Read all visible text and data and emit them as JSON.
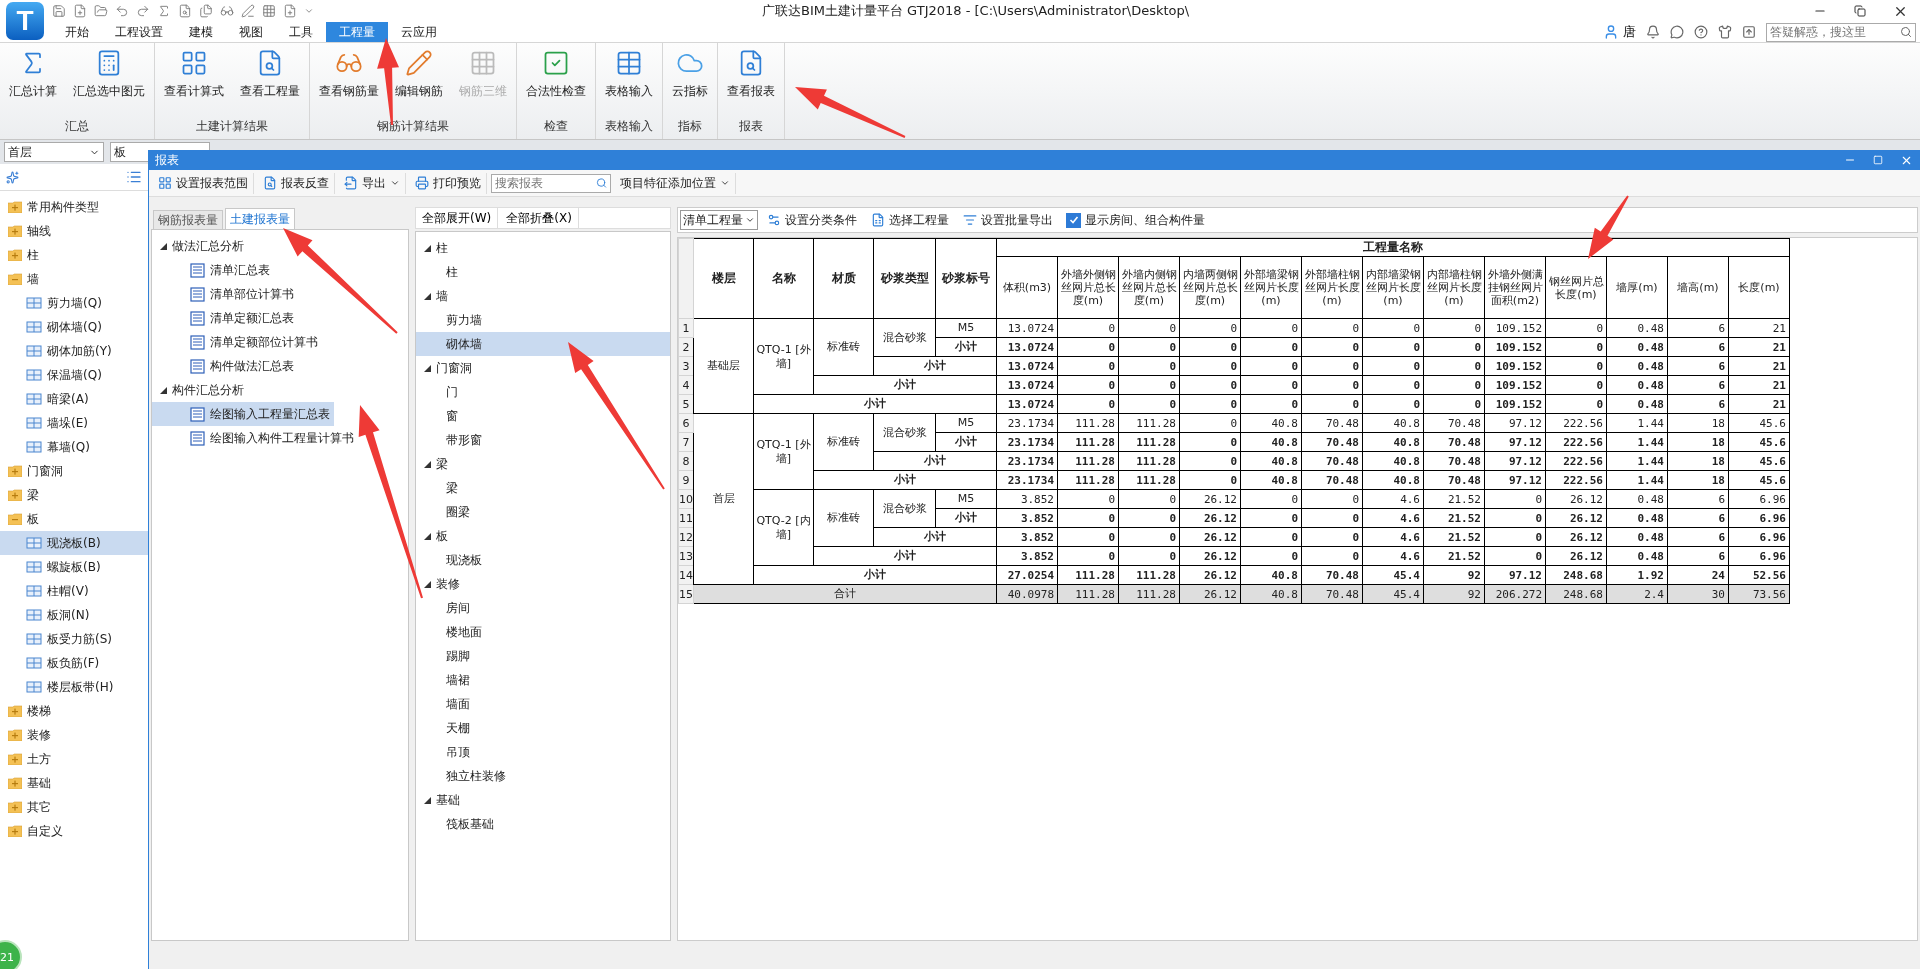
{
  "logo": {
    "text": "T"
  },
  "window": {
    "title": "广联达BIM土建计量平台 GTJ2018 - [C:\\Users\\Administrator\\Desktop\\"
  },
  "user": {
    "name": "唐"
  },
  "help_search": {
    "placeholder": "答疑解惑，搜这里"
  },
  "menu_tabs": [
    {
      "label": "开始",
      "selected": false
    },
    {
      "label": "工程设置",
      "selected": false
    },
    {
      "label": "建模",
      "selected": false
    },
    {
      "label": "视图",
      "selected": false
    },
    {
      "label": "工具",
      "selected": false
    },
    {
      "label": "工程量",
      "selected": true
    },
    {
      "label": "云应用",
      "selected": false
    }
  ],
  "ribbon_groups": [
    {
      "label": "汇总",
      "buttons": [
        {
          "label": "汇总计算",
          "disabled": false
        },
        {
          "label": "汇总选中图元",
          "disabled": false
        }
      ]
    },
    {
      "label": "土建计算结果",
      "buttons": [
        {
          "label": "查看计算式",
          "disabled": false
        },
        {
          "label": "查看工程量",
          "disabled": false
        }
      ]
    },
    {
      "label": "钢筋计算结果",
      "buttons": [
        {
          "label": "查看钢筋量",
          "disabled": false
        },
        {
          "label": "编辑钢筋",
          "disabled": false
        },
        {
          "label": "钢筋三维",
          "disabled": true
        }
      ]
    },
    {
      "label": "检查",
      "buttons": [
        {
          "label": "合法性检查",
          "disabled": false
        }
      ]
    },
    {
      "label": "表格输入",
      "buttons": [
        {
          "label": "表格输入",
          "disabled": false
        }
      ]
    },
    {
      "label": "指标",
      "buttons": [
        {
          "label": "云指标",
          "disabled": false
        }
      ]
    },
    {
      "label": "报表",
      "buttons": [
        {
          "label": "查看报表",
          "disabled": false
        }
      ]
    }
  ],
  "floor_select": {
    "value": "首层"
  },
  "type_select": {
    "value": "板"
  },
  "component_tree": [
    {
      "label": "常用构件类型",
      "expanded": false
    },
    {
      "label": "轴线",
      "expanded": false
    },
    {
      "label": "柱",
      "expanded": false
    },
    {
      "label": "墙",
      "expanded": true,
      "children": [
        {
          "label": "剪力墙(Q)",
          "selected": false
        },
        {
          "label": "砌体墙(Q)",
          "selected": false
        },
        {
          "label": "砌体加筋(Y)",
          "selected": false
        },
        {
          "label": "保温墙(Q)",
          "selected": false
        },
        {
          "label": "暗梁(A)",
          "selected": false
        },
        {
          "label": "墙垛(E)",
          "selected": false
        },
        {
          "label": "幕墙(Q)",
          "selected": false
        }
      ]
    },
    {
      "label": "门窗洞",
      "expanded": false
    },
    {
      "label": "梁",
      "expanded": false
    },
    {
      "label": "板",
      "expanded": true,
      "children": [
        {
          "label": "现浇板(B)",
          "selected": true
        },
        {
          "label": "螺旋板(B)",
          "selected": false
        },
        {
          "label": "柱帽(V)",
          "selected": false
        },
        {
          "label": "板洞(N)",
          "selected": false
        },
        {
          "label": "板受力筋(S)",
          "selected": false
        },
        {
          "label": "板负筋(F)",
          "selected": false
        },
        {
          "label": "楼层板带(H)",
          "selected": false
        }
      ]
    },
    {
      "label": "楼梯",
      "expanded": false
    },
    {
      "label": "装修",
      "expanded": false
    },
    {
      "label": "土方",
      "expanded": false
    },
    {
      "label": "基础",
      "expanded": false
    },
    {
      "label": "其它",
      "expanded": false
    },
    {
      "label": "自定义",
      "expanded": false
    }
  ],
  "badge": {
    "text": "21"
  },
  "report_dialog": {
    "title": "报表",
    "toolbar": [
      {
        "kind": "button",
        "label": "设置报表范围"
      },
      {
        "kind": "button",
        "label": "报表反查"
      },
      {
        "kind": "menu",
        "label": "导出"
      },
      {
        "kind": "button",
        "label": "打印预览"
      },
      {
        "kind": "search",
        "placeholder": "搜索报表"
      },
      {
        "kind": "menu",
        "label": "项目特征添加位置"
      }
    ],
    "tabs": [
      {
        "label": "钢筋报表量",
        "selected": false
      },
      {
        "label": "土建报表量",
        "selected": true
      }
    ],
    "report_tree": [
      {
        "label": "做法汇总分析",
        "expanded": true,
        "children": [
          {
            "label": "清单汇总表",
            "selected": false
          },
          {
            "label": "清单部位计算书",
            "selected": false
          },
          {
            "label": "清单定额汇总表",
            "selected": false
          },
          {
            "label": "清单定额部位计算书",
            "selected": false
          },
          {
            "label": "构件做法汇总表",
            "selected": false
          }
        ]
      },
      {
        "label": "构件汇总分析",
        "expanded": true,
        "children": [
          {
            "label": "绘图输入工程量汇总表",
            "selected": true
          },
          {
            "label": "绘图输入构件工程量计算书",
            "selected": false
          }
        ]
      }
    ],
    "expand_buttons": [
      "全部展开(W)",
      "全部折叠(X)"
    ],
    "category_tree": [
      {
        "label": "柱",
        "expanded": true,
        "children": [
          {
            "label": "柱",
            "selected": false
          }
        ]
      },
      {
        "label": "墙",
        "expanded": true,
        "children": [
          {
            "label": "剪力墙",
            "selected": false
          },
          {
            "label": "砌体墙",
            "selected": true
          }
        ]
      },
      {
        "label": "门窗洞",
        "expanded": true,
        "children": [
          {
            "label": "门",
            "selected": false
          },
          {
            "label": "窗",
            "selected": false
          },
          {
            "label": "带形窗",
            "selected": false
          }
        ]
      },
      {
        "label": "梁",
        "expanded": true,
        "children": [
          {
            "label": "梁",
            "selected": false
          },
          {
            "label": "圈梁",
            "selected": false
          }
        ]
      },
      {
        "label": "板",
        "expanded": true,
        "children": [
          {
            "label": "现浇板",
            "selected": false
          }
        ]
      },
      {
        "label": "装修",
        "expanded": true,
        "children": [
          {
            "label": "房间",
            "selected": false
          },
          {
            "label": "楼地面",
            "selected": false
          },
          {
            "label": "踢脚",
            "selected": false
          },
          {
            "label": "墙裙",
            "selected": false
          },
          {
            "label": "墙面",
            "selected": false
          },
          {
            "label": "天棚",
            "selected": false
          },
          {
            "label": "吊顶",
            "selected": false
          },
          {
            "label": "独立柱装修",
            "selected": false
          }
        ]
      },
      {
        "label": "基础",
        "expanded": true,
        "children": [
          {
            "label": "筏板基础",
            "selected": false
          }
        ]
      }
    ],
    "table_toolbar": [
      {
        "kind": "select",
        "value": "清单工程量"
      },
      {
        "kind": "button",
        "label": "设置分类条件"
      },
      {
        "kind": "button",
        "label": "选择工程量"
      },
      {
        "kind": "button",
        "label": "设置批量导出"
      },
      {
        "kind": "checkbox",
        "label": "显示房间、组合构件量",
        "checked": true
      }
    ],
    "table": {
      "group_header": "工程量名称",
      "label_columns": [
        "楼层",
        "名称",
        "材质",
        "砂浆类型",
        "砂浆标号"
      ],
      "value_columns": [
        "体积(m3)",
        "外墙外侧钢丝网片总长度(m)",
        "外墙内侧钢丝网片总长度(m)",
        "内墙两侧钢丝网片总长度(m)",
        "外部墙梁钢丝网片长度(m)",
        "外部墙柱钢丝网片长度(m)",
        "内部墙梁钢丝网片长度(m)",
        "内部墙柱钢丝网片长度(m)",
        "外墙外侧满挂钢丝网片面积(m2)",
        "钢丝网片总长度(m)",
        "墙厚(m)",
        "墙高(m)",
        "长度(m)"
      ],
      "rows": [
        {
          "number": "1",
          "kind": "detail",
          "labels": [
            "基础层",
            "QTQ-1 [外墙]",
            "标准砖",
            "混合砂浆",
            "M5"
          ],
          "values": [
            "13.0724",
            "0",
            "0",
            "0",
            "0",
            "0",
            "0",
            "0",
            "109.152",
            "0",
            "0.48",
            "6",
            "21"
          ]
        },
        {
          "number": "2",
          "kind": "subtotal",
          "labels": [
            "小计"
          ],
          "values": [
            "13.0724",
            "0",
            "0",
            "0",
            "0",
            "0",
            "0",
            "0",
            "109.152",
            "0",
            "0.48",
            "6",
            "21"
          ]
        },
        {
          "number": "3",
          "kind": "subtotal",
          "labels": [
            "小计"
          ],
          "values": [
            "13.0724",
            "0",
            "0",
            "0",
            "0",
            "0",
            "0",
            "0",
            "109.152",
            "0",
            "0.48",
            "6",
            "21"
          ]
        },
        {
          "number": "4",
          "kind": "subtotal",
          "labels": [
            "小计"
          ],
          "values": [
            "13.0724",
            "0",
            "0",
            "0",
            "0",
            "0",
            "0",
            "0",
            "109.152",
            "0",
            "0.48",
            "6",
            "21"
          ]
        },
        {
          "number": "5",
          "kind": "subtotal",
          "labels": [
            "小计"
          ],
          "values": [
            "13.0724",
            "0",
            "0",
            "0",
            "0",
            "0",
            "0",
            "0",
            "109.152",
            "0",
            "0.48",
            "6",
            "21"
          ]
        },
        {
          "number": "6",
          "kind": "detail",
          "labels": [
            "首层",
            "QTQ-1 [外墙]",
            "标准砖",
            "混合砂浆",
            "M5"
          ],
          "values": [
            "23.1734",
            "111.28",
            "111.28",
            "0",
            "40.8",
            "70.48",
            "40.8",
            "70.48",
            "97.12",
            "222.56",
            "1.44",
            "18",
            "45.6"
          ]
        },
        {
          "number": "7",
          "kind": "subtotal",
          "labels": [
            "小计"
          ],
          "values": [
            "23.1734",
            "111.28",
            "111.28",
            "0",
            "40.8",
            "70.48",
            "40.8",
            "70.48",
            "97.12",
            "222.56",
            "1.44",
            "18",
            "45.6"
          ]
        },
        {
          "number": "8",
          "kind": "subtotal",
          "labels": [
            "小计"
          ],
          "values": [
            "23.1734",
            "111.28",
            "111.28",
            "0",
            "40.8",
            "70.48",
            "40.8",
            "70.48",
            "97.12",
            "222.56",
            "1.44",
            "18",
            "45.6"
          ]
        },
        {
          "number": "9",
          "kind": "subtotal",
          "labels": [
            "小计"
          ],
          "values": [
            "23.1734",
            "111.28",
            "111.28",
            "0",
            "40.8",
            "70.48",
            "40.8",
            "70.48",
            "97.12",
            "222.56",
            "1.44",
            "18",
            "45.6"
          ]
        },
        {
          "number": "10",
          "kind": "detail",
          "labels": [
            "QTQ-2 [内墙]",
            "标准砖",
            "混合砂浆",
            "M5"
          ],
          "values": [
            "3.852",
            "0",
            "0",
            "26.12",
            "0",
            "0",
            "4.6",
            "21.52",
            "0",
            "26.12",
            "0.48",
            "6",
            "6.96"
          ]
        },
        {
          "number": "11",
          "kind": "subtotal",
          "labels": [
            "小计"
          ],
          "values": [
            "3.852",
            "0",
            "0",
            "26.12",
            "0",
            "0",
            "4.6",
            "21.52",
            "0",
            "26.12",
            "0.48",
            "6",
            "6.96"
          ]
        },
        {
          "number": "12",
          "kind": "subtotal",
          "labels": [
            "小计"
          ],
          "values": [
            "3.852",
            "0",
            "0",
            "26.12",
            "0",
            "0",
            "4.6",
            "21.52",
            "0",
            "26.12",
            "0.48",
            "6",
            "6.96"
          ]
        },
        {
          "number": "13",
          "kind": "subtotal",
          "labels": [
            "小计"
          ],
          "values": [
            "3.852",
            "0",
            "0",
            "26.12",
            "0",
            "0",
            "4.6",
            "21.52",
            "0",
            "26.12",
            "0.48",
            "6",
            "6.96"
          ]
        },
        {
          "number": "14",
          "kind": "subtotal",
          "labels": [
            "小计"
          ],
          "values": [
            "27.0254",
            "111.28",
            "111.28",
            "26.12",
            "40.8",
            "70.48",
            "45.4",
            "92",
            "97.12",
            "248.68",
            "1.92",
            "24",
            "52.56"
          ]
        },
        {
          "number": "15",
          "kind": "total",
          "labels": [
            "合计"
          ],
          "values": [
            "40.0978",
            "111.28",
            "111.28",
            "26.12",
            "40.8",
            "70.48",
            "45.4",
            "92",
            "206.272",
            "248.68",
            "2.4",
            "30",
            "73.56"
          ]
        }
      ]
    }
  }
}
